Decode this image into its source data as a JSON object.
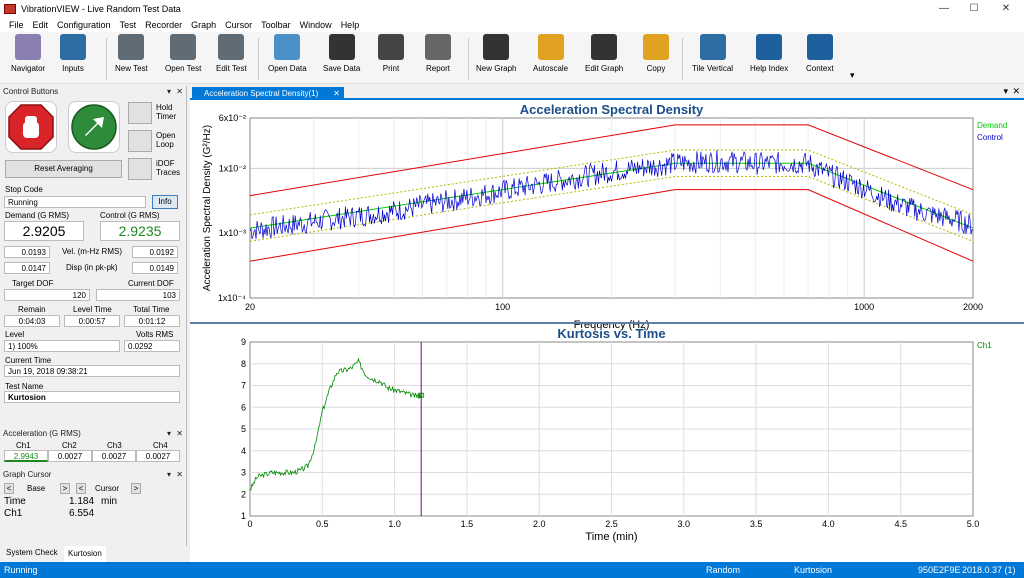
{
  "window": {
    "title": "VibrationVIEW - Live Random Test Data",
    "min": "—",
    "max": "☐",
    "close": "✕"
  },
  "menu": [
    "File",
    "Edit",
    "Configuration",
    "Test",
    "Recorder",
    "Graph",
    "Cursor",
    "Toolbar",
    "Window",
    "Help"
  ],
  "toolbar": [
    {
      "label": "Navigator",
      "icon": "navigator-icon",
      "color": "#8a7fb0"
    },
    {
      "label": "Inputs",
      "icon": "inputs-icon",
      "color": "#2d6da3"
    },
    {
      "label": "New Test",
      "icon": "new-test-gear-icon",
      "color": "#5f6b75"
    },
    {
      "label": "Open Test",
      "icon": "open-test-gear-icon",
      "color": "#5f6b75"
    },
    {
      "label": "Edit Test",
      "icon": "edit-test-gear-icon",
      "color": "#5f6b75"
    },
    {
      "label": "Open Data",
      "icon": "open-data-folder-icon",
      "color": "#4a90c8"
    },
    {
      "label": "Save Data",
      "icon": "save-disk-icon",
      "color": "#333333"
    },
    {
      "label": "Print",
      "icon": "printer-icon",
      "color": "#444444"
    },
    {
      "label": "Report",
      "icon": "report-icon",
      "color": "#666666"
    },
    {
      "label": "New Graph",
      "icon": "new-graph-icon",
      "color": "#333333"
    },
    {
      "label": "Autoscale",
      "icon": "autoscale-icon",
      "color": "#e0a020"
    },
    {
      "label": "Edit Graph",
      "icon": "edit-graph-icon",
      "color": "#333333"
    },
    {
      "label": "Copy",
      "icon": "copy-icon",
      "color": "#e0a020"
    },
    {
      "label": "Tile Vertical",
      "icon": "tile-vertical-icon",
      "color": "#2d6da3"
    },
    {
      "label": "Help Index",
      "icon": "help-index-icon",
      "color": "#1e5f9e"
    },
    {
      "label": "Context",
      "icon": "context-help-icon",
      "color": "#1e5f9e"
    }
  ],
  "control_buttons": {
    "title": "Control Buttons",
    "hold_timer": "Hold Timer",
    "open_loop": "Open Loop",
    "idof_traces": "iDOF Traces",
    "reset_averaging": "Reset Averaging",
    "stop_code_label": "Stop Code",
    "stop_code": "Running",
    "info": "Info",
    "demand_label": "Demand (G RMS)",
    "demand": "2.9205",
    "control_label": "Control (G RMS)",
    "control": "2.9235",
    "vel_demand": "0.0193",
    "vel_label": "Vel. (m-Hz RMS)",
    "vel_control": "0.0192",
    "disp_demand": "0.0147",
    "disp_label": "Disp (in pk-pk)",
    "disp_control": "0.0149",
    "target_dof_label": "Target DOF",
    "target_dof": "120",
    "current_dof_label": "Current DOF",
    "current_dof": "103",
    "remain_label": "Remain",
    "remain": "0:04:03",
    "level_time_label": "Level Time",
    "level_time": "0:00:57",
    "total_time_label": "Total Time",
    "total_time": "0:01:12",
    "level_label": "Level",
    "level": "1) 100%",
    "volts_label": "Volts RMS",
    "volts": "0.0292",
    "current_time_label": "Current Time",
    "current_time": "Jun 19, 2018 09:38:21",
    "test_name_label": "Test Name",
    "test_name": "Kurtosion"
  },
  "acceleration": {
    "title": "Acceleration (G RMS)",
    "channels": [
      "Ch1",
      "Ch2",
      "Ch3",
      "Ch4"
    ],
    "values": [
      "2.9943",
      "0.0027",
      "0.0027",
      "0.0027"
    ]
  },
  "graph_cursor": {
    "title": "Graph Cursor",
    "base": "Base",
    "cursor": "Cursor",
    "time_label": "Time",
    "time_value": "1.184",
    "time_unit": "min",
    "ch1_label": "Ch1",
    "ch1_value": "6.554"
  },
  "bottom_tabs": [
    "System Check",
    "Kurtosion"
  ],
  "graph_tab": "Acceleration Spectral Density(1)",
  "status": {
    "left": "Running",
    "mode": "Random",
    "test": "Kurtosion",
    "serial": "950E2F9E",
    "version": "2018.0.37 (1)"
  },
  "colors": {
    "accent": "#0078d7",
    "title_blue": "#1a4f8a",
    "demand": "#00cc00",
    "control": "#0000cc",
    "tolerance": "#e00000",
    "abort_dotted": "#b8b800",
    "kurtosis": "#008800",
    "cursor": "#800080"
  },
  "chart_data": [
    {
      "type": "line",
      "title": "Acceleration Spectral Density",
      "xlabel": "Frequency (Hz)",
      "ylabel": "Acceleration Spectral Density (G²/Hz)",
      "xscale": "log",
      "yscale": "log",
      "xlim": [
        20,
        2000
      ],
      "ylim": [
        0.0001,
        0.06
      ],
      "xticks": [
        "20",
        "100",
        "1000",
        "2000"
      ],
      "yticks": [
        "6x10⁻²",
        "1x10⁻²",
        "1x10⁻³",
        "1x10⁻⁴"
      ],
      "legend": [
        "Demand",
        "Control"
      ],
      "series": [
        {
          "name": "Demand",
          "x": [
            20,
            300,
            700,
            2000
          ],
          "y": [
            0.0012,
            0.012,
            0.012,
            0.0012
          ]
        },
        {
          "name": "Control",
          "x": [
            20,
            50,
            100,
            200,
            300,
            400,
            500,
            600,
            700,
            800,
            1000,
            1200,
            1500,
            1800,
            2000
          ],
          "y": [
            0.0011,
            0.0022,
            0.0045,
            0.009,
            0.012,
            0.013,
            0.012,
            0.012,
            0.012,
            0.008,
            0.005,
            0.003,
            0.002,
            0.0016,
            0.0013
          ]
        }
      ],
      "limits": {
        "upper_abort": [
          [
            20,
            300,
            700,
            2000
          ],
          [
            0.0038,
            0.047,
            0.047,
            0.0047
          ]
        ],
        "lower_abort": [
          [
            20,
            300,
            700,
            2000
          ],
          [
            0.00037,
            0.0047,
            0.0047,
            0.00037
          ]
        ]
      }
    },
    {
      "type": "line",
      "title": "Kurtosis vs. Time",
      "xlabel": "Time (min)",
      "ylabel": "",
      "xlim": [
        0,
        5
      ],
      "ylim": [
        1,
        9
      ],
      "xticks": [
        "0",
        "0.5",
        "1.0",
        "1.5",
        "2.0",
        "2.5",
        "3.0",
        "3.5",
        "4.0",
        "4.5",
        "5.0"
      ],
      "yticks": [
        "1",
        "2",
        "3",
        "4",
        "5",
        "6",
        "7",
        "8",
        "9"
      ],
      "legend": [
        "Ch1"
      ],
      "cursor_x": 1.184,
      "series": [
        {
          "name": "Ch1",
          "x": [
            0,
            0.05,
            0.1,
            0.15,
            0.2,
            0.25,
            0.3,
            0.35,
            0.4,
            0.45,
            0.5,
            0.55,
            0.6,
            0.65,
            0.7,
            0.75,
            0.8,
            0.85,
            0.9,
            0.95,
            1.0,
            1.05,
            1.1,
            1.15,
            1.184
          ],
          "y": [
            2.2,
            2.8,
            2.9,
            3.0,
            3.0,
            3.0,
            3.0,
            3.1,
            3.3,
            4.2,
            5.8,
            6.8,
            7.6,
            7.7,
            7.8,
            8.1,
            7.5,
            7.3,
            7.2,
            6.9,
            6.8,
            6.7,
            6.6,
            6.5,
            6.55
          ]
        }
      ]
    }
  ]
}
